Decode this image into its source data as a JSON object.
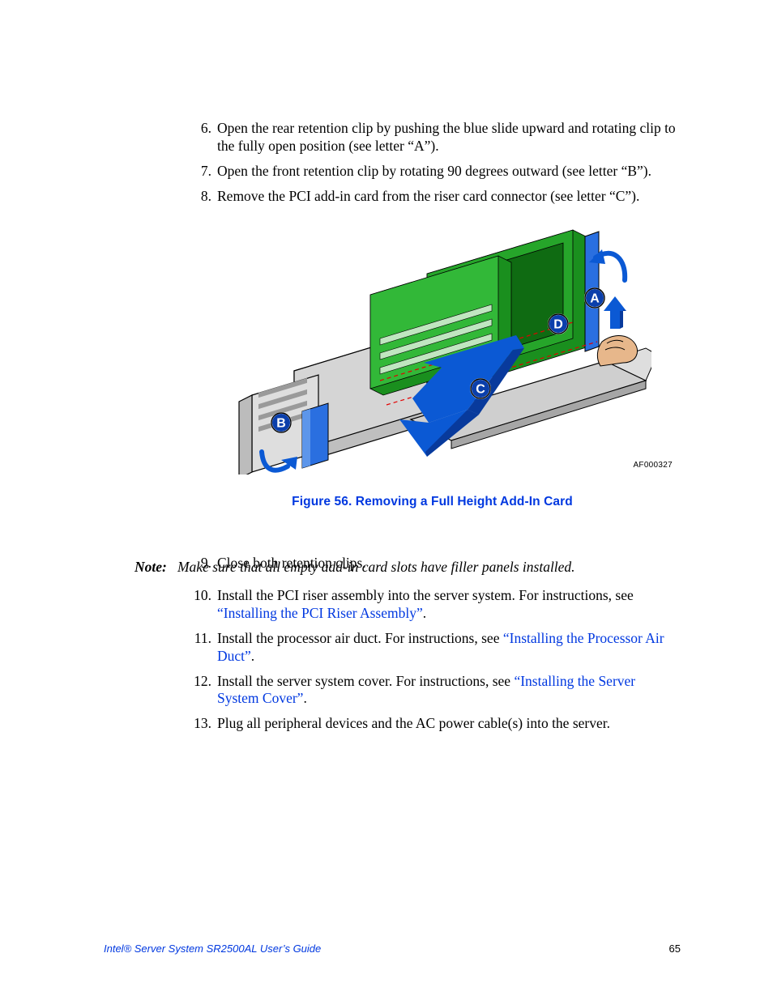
{
  "steps_a": [
    {
      "n": "6.",
      "text": "Open the rear retention clip by pushing the blue slide upward and rotating clip to the fully open position (see letter “A”)."
    },
    {
      "n": "7.",
      "text": "Open the front retention clip by rotating 90 degrees outward (see letter “B”)."
    },
    {
      "n": "8.",
      "text": "Remove the PCI add-in card from the riser card connector (see letter “C”)."
    }
  ],
  "figure": {
    "id": "AF000327",
    "caption": "Figure 56. Removing a Full Height Add-In Card",
    "callouts": {
      "a": "A",
      "b": "B",
      "c": "C",
      "d": "D"
    }
  },
  "step9": {
    "n": "9.",
    "text": "Close both retention clips."
  },
  "note": {
    "label": "Note:",
    "text": "Make sure that all empty add-in card slots have filler panels installed."
  },
  "steps_b": [
    {
      "n": "10.",
      "pre": "Install the PCI riser assembly into the server system. For instructions, see ",
      "link": "“Installing the PCI Riser Assembly”",
      "post": "."
    },
    {
      "n": "11.",
      "pre": "Install the processor air duct. For instructions, see ",
      "link": "“Installing the Processor Air Duct”",
      "post": "."
    },
    {
      "n": "12.",
      "pre": "Install the server system cover. For instructions, see ",
      "link": "“Installing the Server System Cover”",
      "post": "."
    },
    {
      "n": "13.",
      "pre": "Plug all peripheral devices and the AC power cable(s) into the server.",
      "link": "",
      "post": ""
    }
  ],
  "footer": {
    "title": "Intel® Server System SR2500AL User’s Guide",
    "page": "65"
  }
}
